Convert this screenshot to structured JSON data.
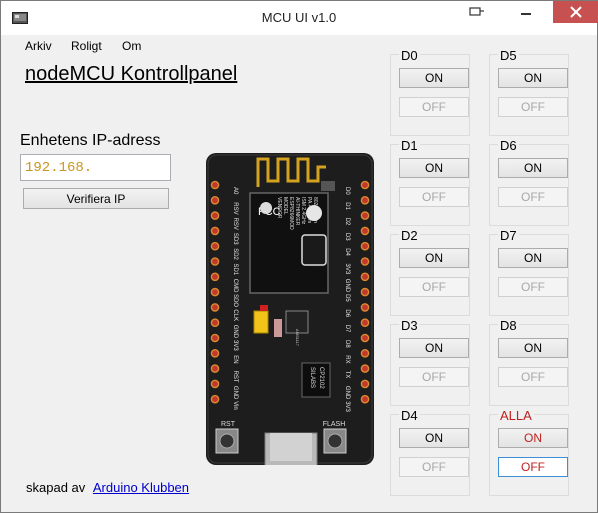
{
  "window": {
    "title": "MCU UI v1.0"
  },
  "menu": {
    "items": [
      "Arkiv",
      "Roligt",
      "Om"
    ]
  },
  "main": {
    "heading": "nodeMCU Kontrollpanel",
    "ip_label": "Enhetens IP-adress",
    "ip_value": "192.168.",
    "verify_button": "Verifiera IP"
  },
  "footer": {
    "created_by": "skapad av",
    "link": "Arduino Klubben"
  },
  "pins": {
    "on_label": "ON",
    "off_label": "OFF",
    "groups": [
      {
        "label": "D0"
      },
      {
        "label": "D5"
      },
      {
        "label": "D1"
      },
      {
        "label": "D6"
      },
      {
        "label": "D2"
      },
      {
        "label": "D7"
      },
      {
        "label": "D3"
      },
      {
        "label": "D8"
      },
      {
        "label": "D4"
      },
      {
        "label": "ALLA"
      }
    ]
  },
  "board": {
    "left_pins": [
      "A0",
      "RSV",
      "RSV",
      "SD3",
      "SD2",
      "SD1",
      "CMD",
      "SDO",
      "CLK",
      "GND",
      "3V3",
      "EN",
      "RST",
      "GND",
      "Vin"
    ],
    "right_pins": [
      "D0",
      "D1",
      "D2",
      "D3",
      "D4",
      "3V3",
      "GND",
      "D5",
      "D6",
      "D7",
      "D8",
      "RX",
      "TX",
      "GND",
      "3V3"
    ],
    "buttons": [
      "RST",
      "FLASH"
    ],
    "chip_text": [
      "FCC",
      "VENDOR",
      "MODEL",
      "ESP8266MOD",
      "AI-THINKER",
      "ISM 2.4GHz",
      "PA +25dBm",
      "802.11b/g/n",
      "WiFi"
    ],
    "usb_chip_text": [
      "SILABS",
      "CP2102"
    ],
    "regulator_text": "AMS1117"
  },
  "colors": {
    "close": "#c75050",
    "accent_red": "#c02020",
    "link": "#0000cc"
  }
}
